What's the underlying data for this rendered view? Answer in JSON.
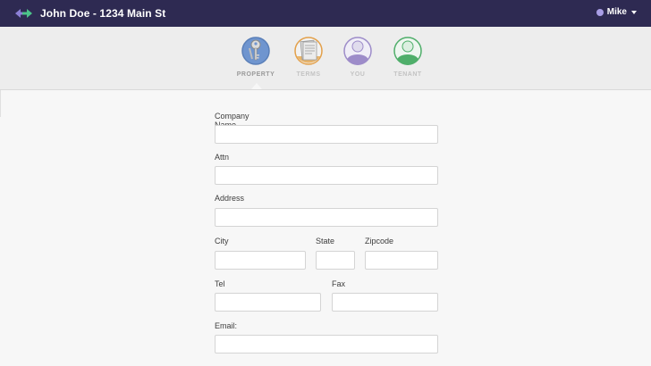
{
  "header": {
    "title": "John Doe - 1234 Main St",
    "logo_icon": "swap-arrows-icon",
    "user_name": "Mike",
    "user_color": "#a99ee6"
  },
  "steps": [
    {
      "label": "PROPERTY",
      "icon": "keys-icon",
      "active": true,
      "color": "#5b84c4"
    },
    {
      "label": "TERMS",
      "icon": "documents-icon",
      "active": false,
      "color": "#e3a04a"
    },
    {
      "label": "YOU",
      "icon": "person-icon",
      "active": false,
      "color": "#9d8cc9"
    },
    {
      "label": "TENANT",
      "icon": "person-icon",
      "active": false,
      "color": "#4fae6a"
    }
  ],
  "form": {
    "company_name": {
      "label": "Company Name",
      "value": ""
    },
    "attn": {
      "label": "Attn",
      "value": ""
    },
    "address": {
      "label": "Address",
      "value": ""
    },
    "city": {
      "label": "City",
      "value": ""
    },
    "state": {
      "label": "State",
      "value": ""
    },
    "zipcode": {
      "label": "Zipcode",
      "value": ""
    },
    "tel": {
      "label": "Tel",
      "value": ""
    },
    "fax": {
      "label": "Fax",
      "value": ""
    },
    "email": {
      "label": "Email:",
      "value": ""
    }
  }
}
